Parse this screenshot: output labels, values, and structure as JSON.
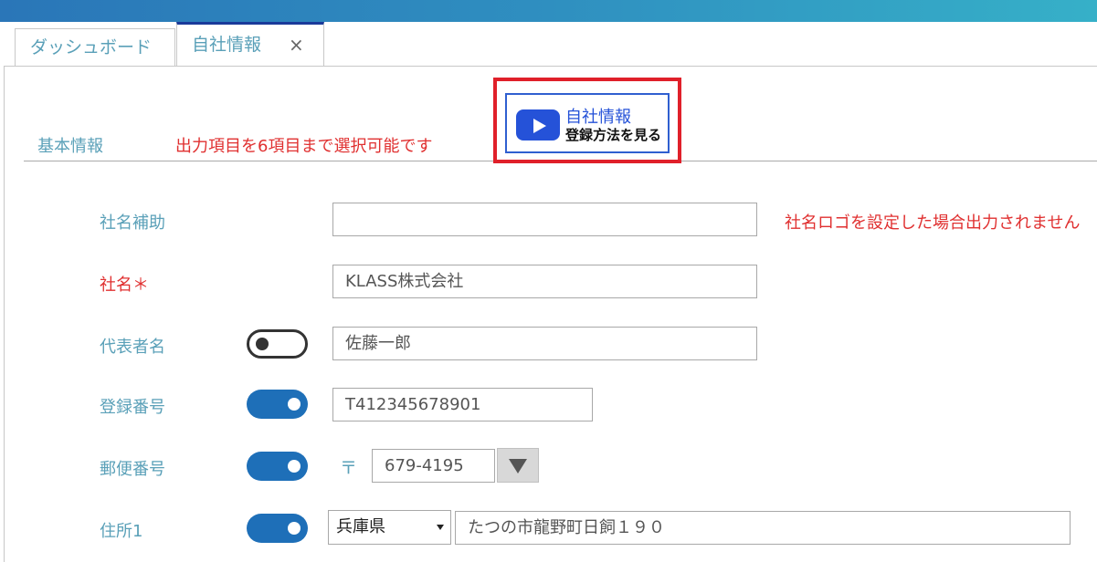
{
  "tabs": [
    {
      "label": "ダッシュボード"
    },
    {
      "label": "自社情報",
      "close": "×"
    }
  ],
  "section": {
    "tab_label": "基本情報",
    "note": "出力項目を6項目まで選択可能です"
  },
  "video_button": {
    "line1": "自社情報",
    "line2": "登録方法を見る"
  },
  "fields": {
    "company_sub": {
      "label": "社名補助",
      "value": "",
      "hint": "社名ロゴを設定した場合出力されません"
    },
    "company_name": {
      "label": "社名＊",
      "value": "KLASS株式会社"
    },
    "representative": {
      "label": "代表者名",
      "value": "佐藤一郎",
      "toggle": "off"
    },
    "registration_no": {
      "label": "登録番号",
      "value": "T412345678901",
      "toggle": "on"
    },
    "postal_code": {
      "label": "郵便番号",
      "mark": "〒",
      "value": "679-4195",
      "toggle": "on"
    },
    "address1": {
      "label": "住所1",
      "prefecture": "兵庫県",
      "value": "たつの市龍野町日飼１９０",
      "toggle": "on"
    }
  },
  "colors": {
    "accent": "#5aa0b8",
    "required": "#e03030",
    "toggle_on": "#1e6fb8",
    "video_border": "#e0202a",
    "video_blue": "#2552d8"
  }
}
